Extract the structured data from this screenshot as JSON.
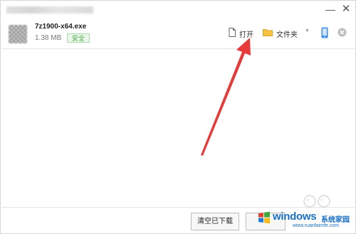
{
  "window": {
    "minimize_symbol": "—",
    "close_symbol": "✕"
  },
  "download": {
    "file_name": "7z1900-x64.exe",
    "file_size": "1.38 MB",
    "badge": "安全",
    "open_label": "打开",
    "folder_label": "文件夹",
    "open_icon": "document-icon",
    "folder_icon": "folder-icon",
    "menu_icon": "chevron-down-icon",
    "phone_icon": "phone-icon",
    "remove_icon": "close-circle-icon"
  },
  "footer": {
    "clear_label": "清空已下载"
  },
  "watermark": {
    "brand": "windows",
    "brand_cn": "系统家园",
    "url": "www.ruanfaimfe.com"
  },
  "colors": {
    "badge_green": "#4aa84a",
    "folder_yellow": "#f5c242",
    "phone_blue": "#3a8ee6",
    "arrow_red": "#e53b3b",
    "watermark_blue": "#1a6fc4"
  }
}
